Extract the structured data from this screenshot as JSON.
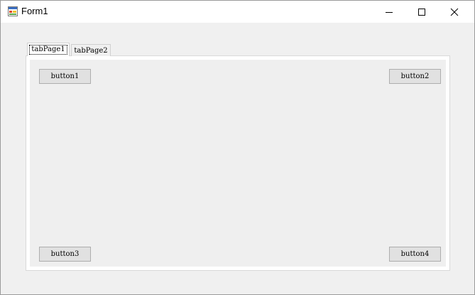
{
  "window": {
    "title": "Form1"
  },
  "titlebar_icons": {
    "app": "form-app-icon",
    "minimize": "minimize-icon",
    "maximize": "maximize-icon",
    "close": "close-icon"
  },
  "tabs": [
    {
      "label": "tabPage1",
      "selected": true
    },
    {
      "label": "tabPage2",
      "selected": false
    }
  ],
  "buttons": {
    "button1": "button1",
    "button2": "button2",
    "button3": "button3",
    "button4": "button4"
  },
  "colors": {
    "client_background": "#f0f0f0",
    "button_face": "#e1e1e1",
    "button_border": "#adadad"
  }
}
